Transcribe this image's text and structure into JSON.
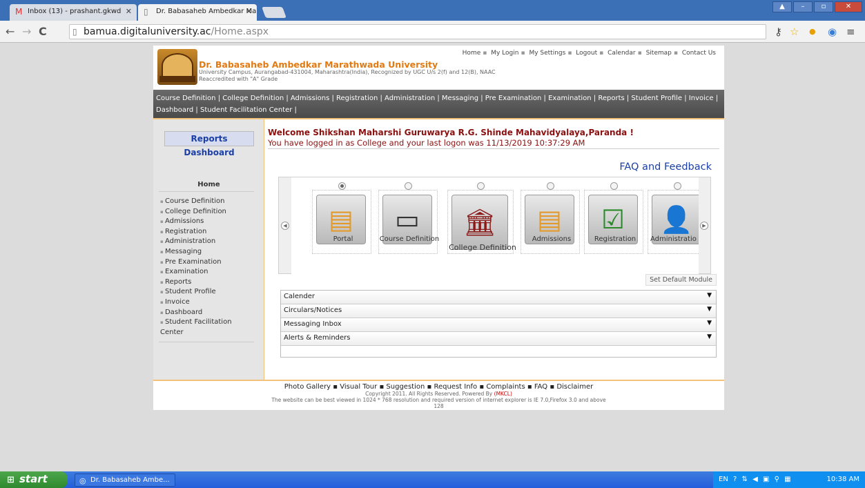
{
  "browser": {
    "tabs": [
      {
        "label": "Inbox (13) - prashant.gkwd",
        "icon": "gmail-icon",
        "active": false
      },
      {
        "label": "Dr. Babasaheb Ambedkar Ma",
        "icon": "page-icon",
        "active": true
      }
    ],
    "address": {
      "host": "bamua.digitaluniversity.ac",
      "path": "/Home.aspx"
    }
  },
  "header": {
    "university_name": "Dr. Babasaheb Ambedkar Marathwada University",
    "address_line": "University Campus, Aurangabad-431004, Maharashtra(India), Recognized by UGC U/s 2(f) and 12(B), NAAC",
    "grade_line": "Reaccredited with \"A\" Grade",
    "toplinks": [
      "Home",
      "My Login",
      "My Settings",
      "Logout",
      "Calendar",
      "Sitemap",
      "Contact Us"
    ]
  },
  "menubar": {
    "text": "Course Definition | College Definition | Admissions | Registration | Administration | Messaging | Pre Examination | Examination | Reports | Student Profile | Invoice | Dashboard | Student Facilitation Center |"
  },
  "sidebar": {
    "reports_dashboard": "Reports Dashboard",
    "home_title": "Home",
    "items": [
      "Course Definition",
      "College Definition",
      "Admissions",
      "Registration",
      "Administration",
      "Messaging",
      "Pre Examination",
      "Examination",
      "Reports",
      "Student Profile",
      "Invoice",
      "Dashboard",
      "Student Facilitation Center"
    ]
  },
  "main": {
    "welcome": "Welcome Shikshan Maharshi Guruwarya R.G. Shinde Mahavidyalaya,Paranda !",
    "logon_info": "You have logged in as College and your last logon was 11/13/2019 10:37:29 AM",
    "faq": "FAQ and Feedback",
    "modules": [
      {
        "label": "Portal",
        "icon": "documents-icon",
        "selected": true
      },
      {
        "label": "Course Definition",
        "icon": "computer-icon",
        "selected": false
      },
      {
        "label": "College Definition",
        "icon": "building-icon",
        "selected": false
      },
      {
        "label": "Admissions",
        "icon": "documents-icon",
        "selected": false
      },
      {
        "label": "Registration",
        "icon": "checklist-icon",
        "selected": false
      },
      {
        "label": "Administratio",
        "icon": "admin-user-icon",
        "selected": false
      }
    ],
    "set_default": "Set Default Module",
    "accordion": [
      "Calender",
      "Circulars/Notices",
      "Messaging Inbox",
      "Alerts & Reminders"
    ]
  },
  "footer": {
    "links": [
      "Photo Gallery",
      "Visual Tour",
      "Suggestion",
      "Request Info",
      "Complaints",
      "FAQ",
      "Disclaimer"
    ],
    "copyright": "Copyright 2011. All Rights Reserved. Powered By",
    "powered": "(MKCL)",
    "best_view": "The website can be best viewed in 1024 * 768 resolution and required version of internet explorer is IE 7.0,Firefox 3.0 and above",
    "counter": "128"
  },
  "taskbar": {
    "start": "start",
    "item": "Dr. Babasaheb Ambe...",
    "lang": "EN",
    "clock": "10:38 AM"
  }
}
